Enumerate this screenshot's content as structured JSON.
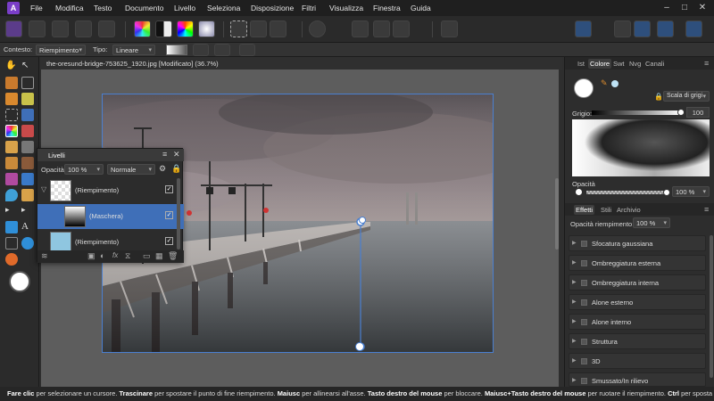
{
  "menubar": {
    "items": [
      "File",
      "Modifica",
      "Testo",
      "Documento",
      "Livello",
      "Seleziona",
      "Disposizione",
      "Filtri",
      "Visualizza",
      "Finestra",
      "Guida"
    ]
  },
  "context": {
    "contesto_label": "Contesto:",
    "contesto_value": "Riempimento",
    "tipo_label": "Tipo:",
    "tipo_value": "Lineare"
  },
  "document": {
    "tab_title": "the-oresund-bridge-753625_1920.jpg [Modificato] (36.7%)"
  },
  "layers_panel": {
    "title": "Livelli",
    "opacity_label": "Opacità:",
    "opacity_value": "100 %",
    "blend_mode": "Normale",
    "rows": [
      {
        "name": "(Riempimento)"
      },
      {
        "name": "(Maschera)"
      },
      {
        "name": "(Riempimento)"
      }
    ]
  },
  "color_panel": {
    "tabs": [
      "Ist",
      "Colore",
      "Swt",
      "Nvg",
      "Canali"
    ],
    "active_tab": "Colore",
    "mode": "Scala di grigi",
    "grigio_label": "Grigio:",
    "grigio_value": "100",
    "opacita_label": "Opacità",
    "opacita_value": "100 %"
  },
  "effects_panel": {
    "tabs": [
      "Effetti",
      "Stili",
      "Archivio"
    ],
    "active_tab": "Effetti",
    "fill_opacity_label": "Opacità riempimento:",
    "fill_opacity_value": "100 %",
    "effects": [
      "Sfocatura gaussiana",
      "Ombreggiatura esterna",
      "Ombreggiatura interna",
      "Alone esterno",
      "Alone interno",
      "Struttura",
      "3D",
      "Smussato/In rilievo"
    ]
  },
  "status": {
    "s1": "Fare clic",
    "s2": " per selezionare un cursore. ",
    "s3": "Trascinare",
    "s4": " per spostare il punto di fine riempimento. ",
    "s5": "Maiusc",
    "s6": " per allinearsi all'asse. ",
    "s7": "Tasto destro del mouse",
    "s8": " per bloccare. ",
    "s9": "Maiusc+Tasto destro del mouse",
    "s10": " per ruotare il riempimento. ",
    "s11": "Ctrl",
    "s12": " per sposta"
  },
  "colors": {
    "accent": "#4a7fd0",
    "app_logo": "#7a3ec8",
    "selected_layer": "#3f6fb8"
  }
}
